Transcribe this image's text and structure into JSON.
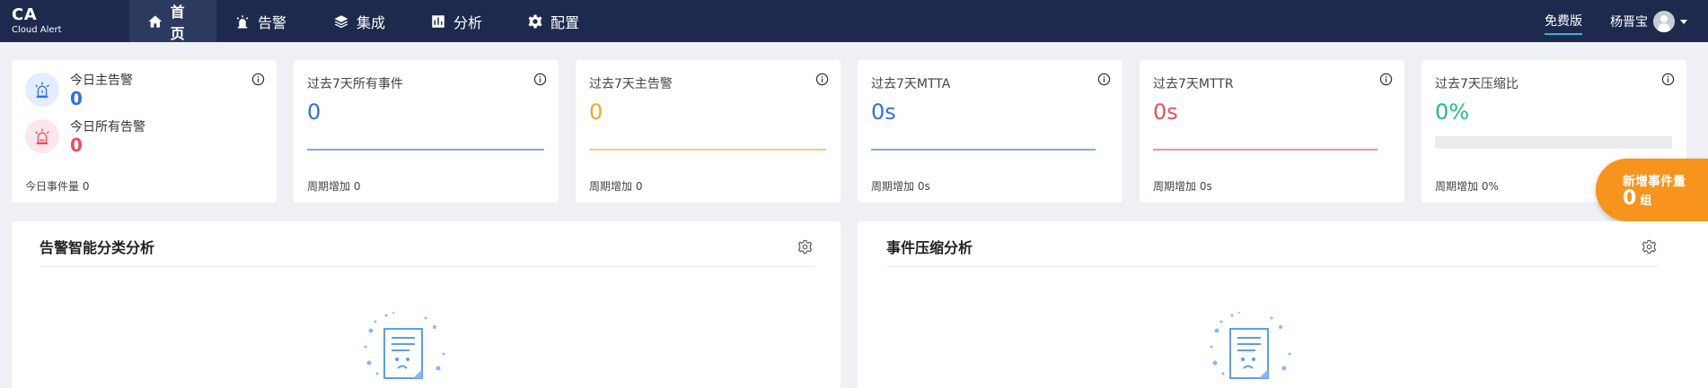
{
  "app": {
    "logo": "CA",
    "logo_sub": "Cloud Alert"
  },
  "nav": [
    {
      "label": "首页",
      "icon": "home-icon",
      "active": true
    },
    {
      "label": "告警",
      "icon": "siren-icon",
      "active": false
    },
    {
      "label": "集成",
      "icon": "layers-icon",
      "active": false
    },
    {
      "label": "分析",
      "icon": "chart-icon",
      "active": false
    },
    {
      "label": "配置",
      "icon": "gear-icon",
      "active": false
    }
  ],
  "header": {
    "plan": "免费版",
    "user_name": "杨晋宝"
  },
  "today": {
    "main_alert_label": "今日主告警",
    "main_alert_value": "0",
    "all_alert_label": "今日所有告警",
    "all_alert_value": "0",
    "events_footer": "今日事件量 0"
  },
  "stats": [
    {
      "title": "过去7天所有事件",
      "value": "0",
      "footer": "周期增加 0",
      "color": "#2f6fe6"
    },
    {
      "title": "过去7天主告警",
      "value": "0",
      "footer": "周期增加 0",
      "color": "#f5a623"
    },
    {
      "title": "过去7天MTTA",
      "value": "0s",
      "footer": "周期增加 0s",
      "color": "#2f6fe6"
    },
    {
      "title": "过去7天MTTR",
      "value": "0s",
      "footer": "周期增加 0s",
      "color": "#ea4e5e"
    },
    {
      "title": "过去7天压缩比",
      "value": "0%",
      "footer": "周期增加 0%",
      "color": "#1fbf7f",
      "progress": 0
    }
  ],
  "new_events": {
    "label": "新增事件量",
    "value": "0",
    "unit": "组"
  },
  "panels": [
    {
      "title": "告警智能分类分析"
    },
    {
      "title": "事件压缩分析"
    }
  ],
  "colors": {
    "nav_bg": "#1d2a4d",
    "accent_orange": "#f7941d",
    "blue": "#2f6fe6",
    "red": "#ea4e5e"
  }
}
